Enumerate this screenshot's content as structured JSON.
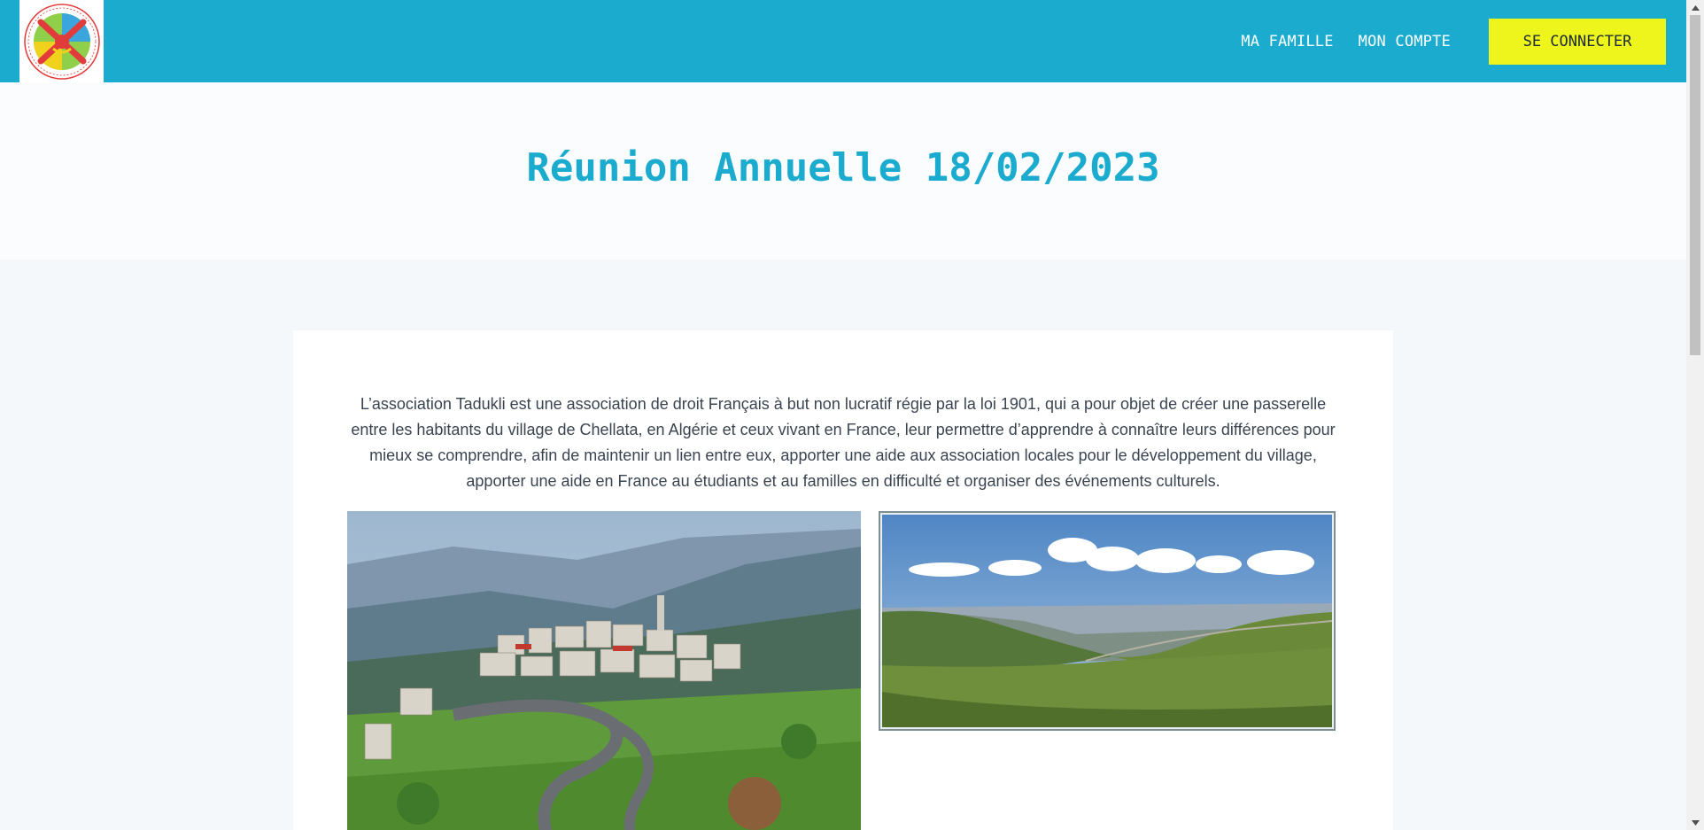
{
  "header": {
    "logo_alt": "Association Socioculturelle Tadukli",
    "logo_text_top": "ASSOCIATION SOCIOCULTURELLE",
    "logo_text_bottom": "DES HABITANTS DE CHELLATA EN FRANCE",
    "logo_name": "TADUKLI",
    "nav": {
      "family_label": "MA FAMILLE",
      "account_label": "MON COMPTE",
      "login_label": "SE CONNECTER"
    },
    "colors": {
      "bar": "#1aabcf",
      "login_button": "#eef51c"
    }
  },
  "hero": {
    "title": "Réunion Annuelle 18/02/2023"
  },
  "content": {
    "intro": "L’association Tadukli est une association de droit Français à but non lucratif régie par la loi 1901, qui a pour objet de créer une passerelle entre les habitants du village de Chellata, en Algérie et ceux vivant en France, leur permettre d’apprendre à connaître leurs différences pour mieux se comprendre, afin de maintenir un lien entre eux, apporter une aide aux association locales pour le développement du village, apporter une aide en France au étudiants et au familles en difficulté et organiser des événements culturels.",
    "photos": [
      {
        "description_icon": "village-photo"
      },
      {
        "description_icon": "valley-panorama-photo"
      }
    ]
  }
}
